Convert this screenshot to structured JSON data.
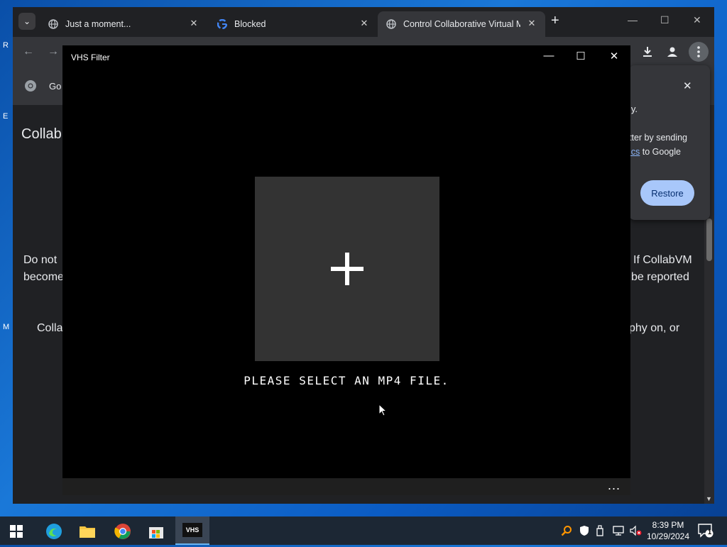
{
  "desktop": {
    "icon_labels": [
      "R",
      "E",
      "M"
    ]
  },
  "browser": {
    "tabs": [
      {
        "title": "Just a moment...",
        "favicon": "globe-icon"
      },
      {
        "title": "Blocked",
        "favicon": "google-g-icon"
      },
      {
        "title": "Control Collaborative Virtual M",
        "favicon": "globe-icon"
      }
    ],
    "bookmark_label": "Go",
    "page": {
      "heading": "Collab",
      "line1_left": "Do not",
      "line1_right": "If CollabVM",
      "line2_left": "become",
      "line2_right": "be reported",
      "line3_left": "Colla",
      "line3_right": "phy on, or"
    },
    "popup": {
      "line1": "ly.",
      "line2": "tter by sending",
      "line3_link": "ics",
      "line3_rest": " to Google",
      "restore_label": "Restore"
    }
  },
  "vhs_window": {
    "title": "VHS Filter",
    "message": "PLEASE SELECT AN MP4 FILE.",
    "more_label": "..."
  },
  "taskbar": {
    "vhs_app_label": "VHS",
    "time": "8:39 PM",
    "date": "10/29/2024",
    "notification_count": "1"
  },
  "colors": {
    "accent": "#a8c7fa",
    "browser_bg": "#202124",
    "taskbar_bg": "#1c2734"
  }
}
